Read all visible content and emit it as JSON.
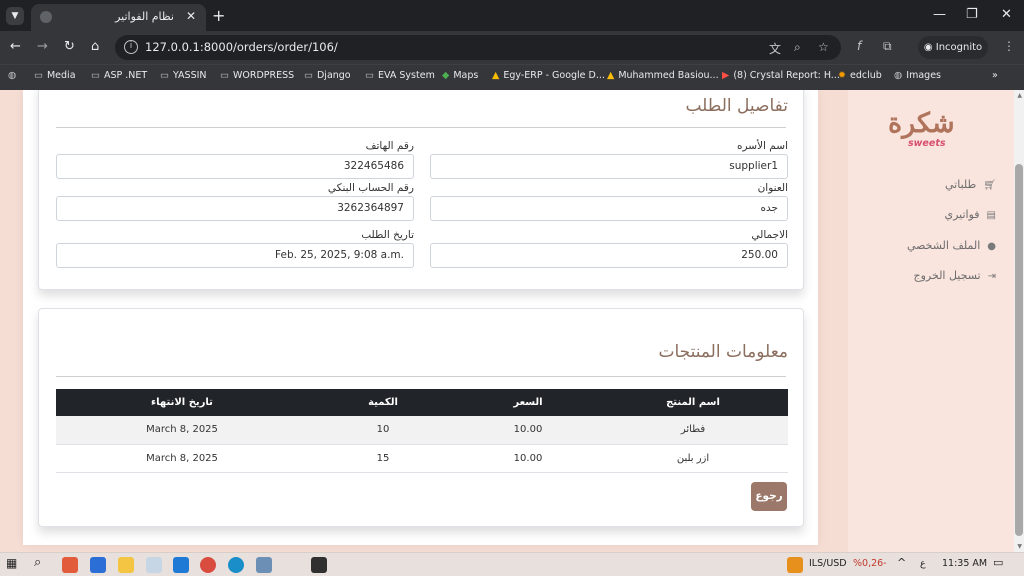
{
  "browser": {
    "tab_title": "نظام الفواتير",
    "url": "127.0.0.1:8000/orders/order/106/",
    "incognito_label": "Incognito",
    "bookmarks": [
      "Media",
      "ASP .NET",
      "YASSIN",
      "WORDPRESS",
      "Django",
      "EVA System",
      "Maps",
      "Egy-ERP - Google D...",
      "Muhammed Basiou...",
      "(8) Crystal Report: H...",
      "edclub",
      "Images"
    ]
  },
  "sidebar": {
    "logo_text": "شكرة",
    "logo_sub": "sweets",
    "items": [
      {
        "label": "طلباتي",
        "icon": "cart-icon"
      },
      {
        "label": "فواتيري",
        "icon": "file-icon"
      },
      {
        "label": "الملف الشخصي",
        "icon": "user-icon"
      },
      {
        "label": "تسجيل الخروج",
        "icon": "logout-icon"
      }
    ]
  },
  "order": {
    "title": "تفاصيل الطلب",
    "family_label": "اسم الأسره",
    "family_value": "supplier1",
    "phone_label": "رقم الهاتف",
    "phone_value": "322465486",
    "address_label": "العنوان",
    "address_value": "جده",
    "bank_label": "رقم الحساب البنكي",
    "bank_value": "3262364897",
    "total_label": "الاجمالي",
    "total_value": "250.00",
    "date_label": "تاريخ الطلب",
    "date_value": "Feb. 25, 2025, 9:08 a.m."
  },
  "products": {
    "title": "معلومات المنتجات",
    "columns": [
      "اسم المنتج",
      "السعر",
      "الكمية",
      "تاريخ الانتهاء"
    ],
    "rows": [
      [
        "فطائر",
        "10.00",
        "10",
        "March 8, 2025"
      ],
      [
        "ازر بلبن",
        "10.00",
        "15",
        "March 8, 2025"
      ]
    ],
    "back_label": "رجوع"
  },
  "taskbar": {
    "currency": "ILS/USD",
    "change": "%0,26-",
    "lang": "ع",
    "time": "11:35 AM"
  }
}
